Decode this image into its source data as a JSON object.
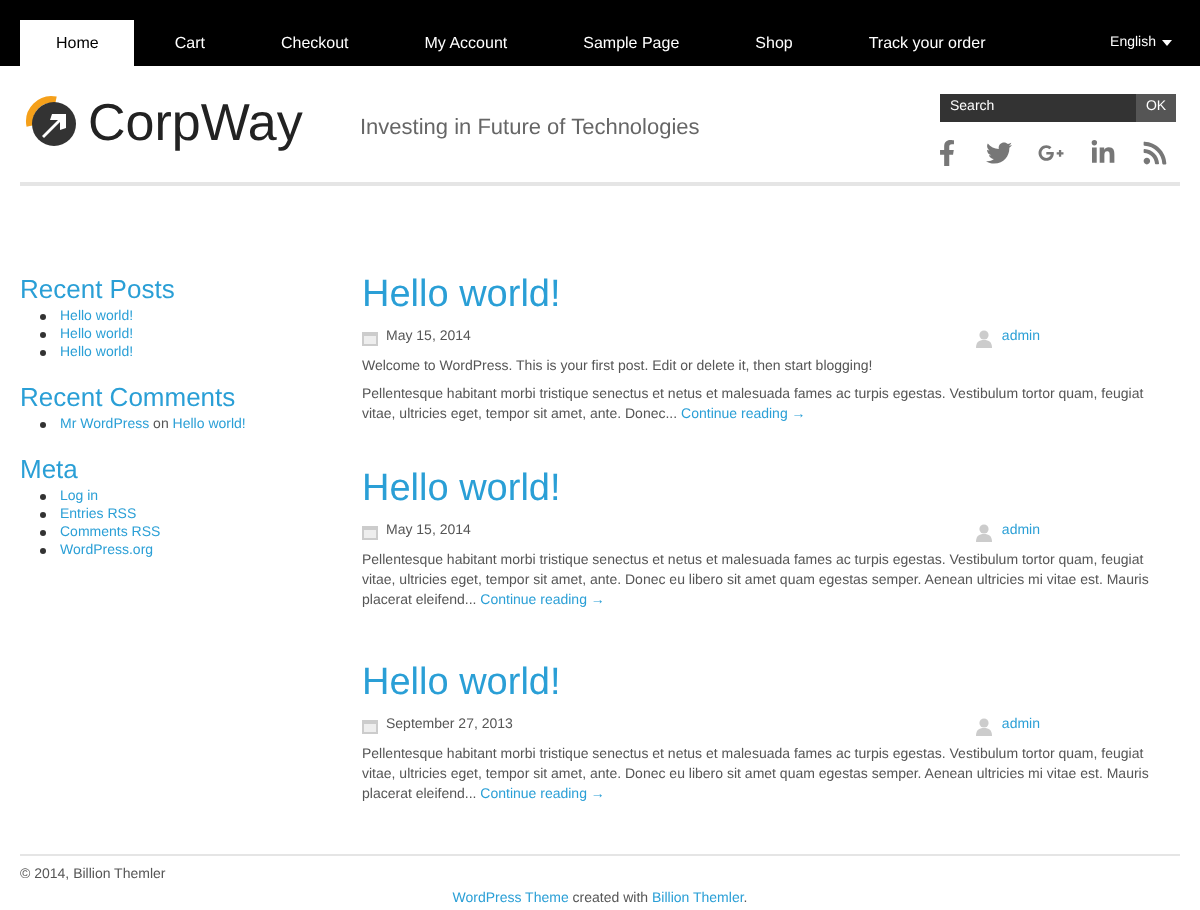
{
  "nav": {
    "tabs": [
      {
        "label": "Home",
        "selected": true
      },
      {
        "label": "Cart",
        "selected": false
      },
      {
        "label": "Checkout",
        "selected": false
      },
      {
        "label": "My Account",
        "selected": false
      },
      {
        "label": "Sample Page",
        "selected": false
      },
      {
        "label": "Shop",
        "selected": false
      },
      {
        "label": "Track your order",
        "selected": false
      }
    ],
    "language": "English"
  },
  "header": {
    "logo": "CorpWay",
    "tagline": "Investing in Future of Technologies",
    "search": {
      "placeholder": "Search",
      "button": "OK"
    }
  },
  "sidebar": [
    {
      "title": "Recent Posts",
      "items": [
        [
          {
            "text": "Hello world!",
            "link": true
          }
        ],
        [
          {
            "text": "Hello world!",
            "link": true
          }
        ],
        [
          {
            "text": "Hello world!",
            "link": true
          }
        ]
      ]
    },
    {
      "title": "Recent Comments",
      "items": [
        [
          {
            "text": "Mr WordPress",
            "link": true
          },
          {
            "text": " on ",
            "link": false
          },
          {
            "text": "Hello world!",
            "link": true
          }
        ]
      ]
    },
    {
      "title": "Meta",
      "items": [
        [
          {
            "text": "Log in",
            "link": true
          }
        ],
        [
          {
            "text": "Entries RSS",
            "link": true
          }
        ],
        [
          {
            "text": "Comments RSS",
            "link": true
          }
        ],
        [
          {
            "text": "WordPress.org",
            "link": true
          }
        ]
      ]
    }
  ],
  "posts": [
    {
      "title": "Hello world!",
      "date": "May 15, 2014",
      "author": "admin",
      "paragraphs": [
        "Welcome to WordPress. This is your first post. Edit or delete it, then start blogging!",
        "Pellentesque habitant morbi tristique senectus et netus et malesuada fames ac turpis egestas. Vestibulum tortor quam, feugiat vitae, ultricies eget, tempor sit amet, ante. Donec..."
      ],
      "more": "Continue reading →"
    },
    {
      "title": "Hello world!",
      "date": "May 15, 2014",
      "author": "admin",
      "paragraphs": [
        "Pellentesque habitant morbi tristique senectus et netus et malesuada fames ac turpis egestas. Vestibulum tortor quam, feugiat vitae, ultricies eget, tempor sit amet, ante. Donec eu libero sit amet quam egestas semper. Aenean ultricies mi vitae est. Mauris placerat eleifend..."
      ],
      "more": "Continue reading →"
    },
    {
      "title": "Hello world!",
      "date": "September 27, 2013",
      "author": "admin",
      "paragraphs": [
        "Pellentesque habitant morbi tristique senectus et netus et malesuada fames ac turpis egestas. Vestibulum tortor quam, feugiat vitae, ultricies eget, tempor sit amet, ante. Donec eu libero sit amet quam egestas semper. Aenean ultricies mi vitae est. Mauris placerat eleifend..."
      ],
      "more": "Continue reading →"
    }
  ],
  "footer": {
    "copyright": "© 2014, Billion Themler",
    "credit": [
      {
        "text": "WordPress Theme",
        "link": true
      },
      {
        "text": " created with ",
        "link": false
      },
      {
        "text": "Billion Themler",
        "link": true
      },
      {
        "text": ".",
        "link": false
      }
    ]
  }
}
